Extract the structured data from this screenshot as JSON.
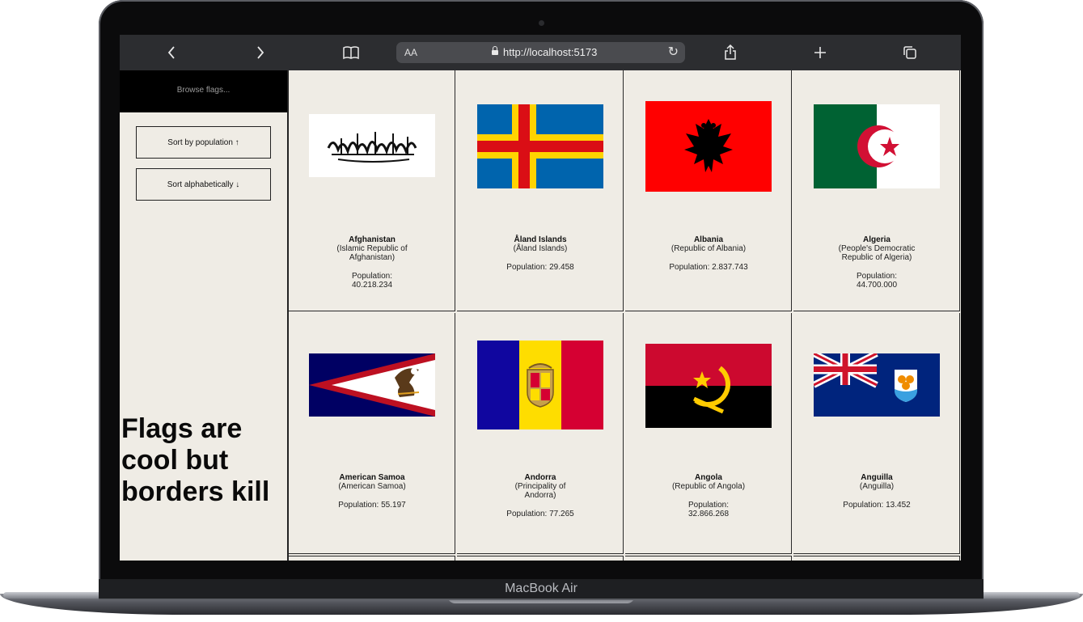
{
  "browser": {
    "aa_label": "AA",
    "url": "http://localhost:5173"
  },
  "sidebar": {
    "header": "Browse flags...",
    "sort_population_label": "Sort by population ↑",
    "sort_alpha_label": "Sort alphabetically ↓",
    "tagline": "Flags are cool but borders kill"
  },
  "countries": [
    {
      "name": "Afghanistan",
      "official": "(Islamic Republic of Afghanistan)",
      "population": "Population: 40.218.234"
    },
    {
      "name": "Åland Islands",
      "official": "(Åland Islands)",
      "population": "Population: 29.458"
    },
    {
      "name": "Albania",
      "official": "(Republic of Albania)",
      "population": "Population: 2.837.743"
    },
    {
      "name": "Algeria",
      "official": "(People's Democratic Republic of Algeria)",
      "population": "Population: 44.700.000"
    },
    {
      "name": "American Samoa",
      "official": "(American Samoa)",
      "population": "Population: 55.197"
    },
    {
      "name": "Andorra",
      "official": "(Principality of Andorra)",
      "population": "Population: 77.265"
    },
    {
      "name": "Angola",
      "official": "(Republic of Angola)",
      "population": "Population: 32.866.268"
    },
    {
      "name": "Anguilla",
      "official": "(Anguilla)",
      "population": "Population: 13.452"
    }
  ],
  "device": {
    "label": "MacBook Air"
  },
  "colors": {
    "page_bg": "#efece5",
    "toolbar_bg": "#2c2d30",
    "sidebar_header_bg": "#000000"
  }
}
